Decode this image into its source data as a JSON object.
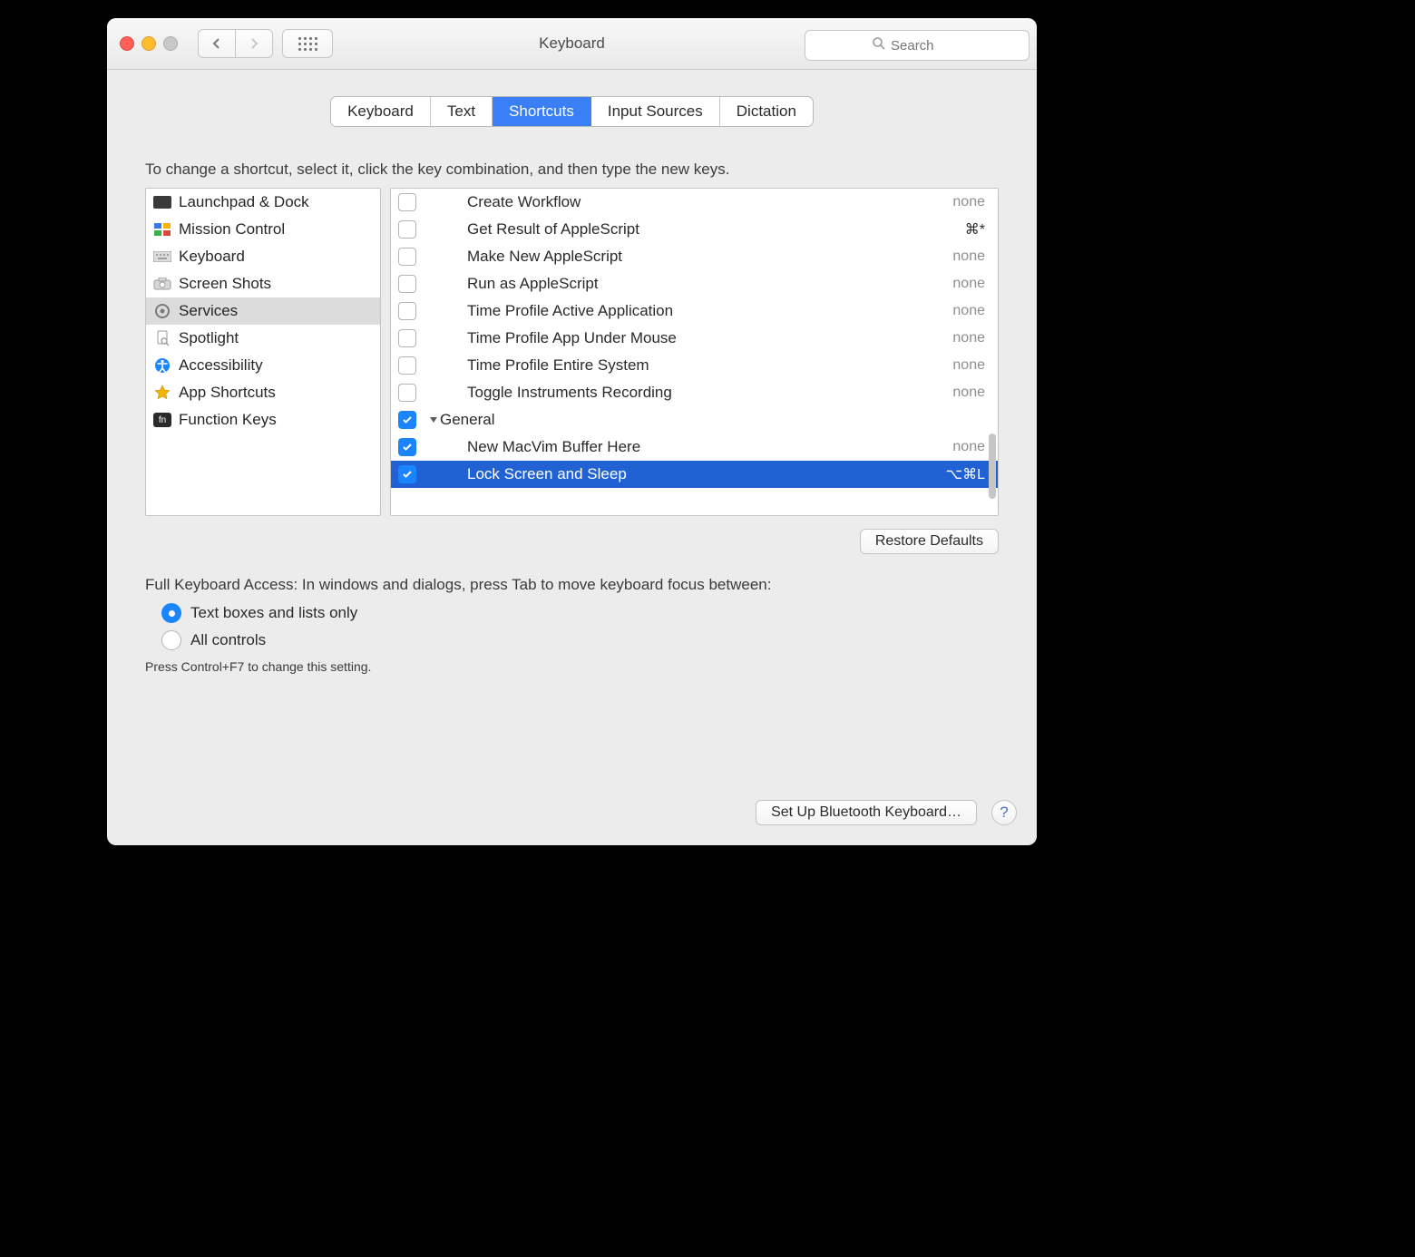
{
  "window": {
    "title": "Keyboard"
  },
  "search": {
    "placeholder": "Search"
  },
  "tabs": {
    "keyboard": "Keyboard",
    "text": "Text",
    "shortcuts": "Shortcuts",
    "input_sources": "Input Sources",
    "dictation": "Dictation"
  },
  "instructions": "To change a shortcut, select it, click the key combination, and then type the new keys.",
  "categories": {
    "launchpad": "Launchpad & Dock",
    "mission_control": "Mission Control",
    "keyboard": "Keyboard",
    "screen_shots": "Screen Shots",
    "services": "Services",
    "spotlight": "Spotlight",
    "accessibility": "Accessibility",
    "app_shortcuts": "App Shortcuts",
    "function_keys": "Function Keys"
  },
  "services": [
    {
      "label": "Create Workflow",
      "checked": false,
      "shortcut": "none"
    },
    {
      "label": "Get Result of AppleScript",
      "checked": false,
      "shortcut": "⌘*"
    },
    {
      "label": "Make New AppleScript",
      "checked": false,
      "shortcut": "none"
    },
    {
      "label": "Run as AppleScript",
      "checked": false,
      "shortcut": "none"
    },
    {
      "label": "Time Profile Active Application",
      "checked": false,
      "shortcut": "none"
    },
    {
      "label": "Time Profile App Under Mouse",
      "checked": false,
      "shortcut": "none"
    },
    {
      "label": "Time Profile Entire System",
      "checked": false,
      "shortcut": "none"
    },
    {
      "label": "Toggle Instruments Recording",
      "checked": false,
      "shortcut": "none"
    }
  ],
  "group": {
    "name": "General",
    "checked": true,
    "items": [
      {
        "label": "New MacVim Buffer Here",
        "checked": true,
        "shortcut": "none",
        "selected": false
      },
      {
        "label": "Lock Screen and Sleep",
        "checked": true,
        "shortcut": "⌥⌘L",
        "selected": true
      }
    ]
  },
  "restore_defaults": "Restore Defaults",
  "fka": {
    "text": "Full Keyboard Access: In windows and dialogs, press Tab to move keyboard focus between:",
    "opt1": "Text boxes and lists only",
    "opt2": "All controls",
    "hint": "Press Control+F7 to change this setting."
  },
  "bluetooth": "Set Up Bluetooth Keyboard…",
  "help": "?"
}
